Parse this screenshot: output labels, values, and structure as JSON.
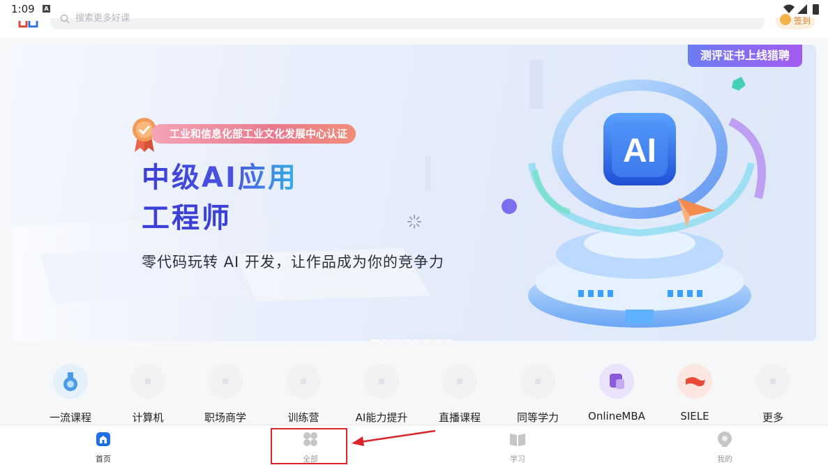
{
  "status_bar": {
    "time": "1:09",
    "notification_badge": "A"
  },
  "header": {
    "search_placeholder": "搜索更多好课",
    "signin_label": "签到"
  },
  "banner": {
    "promo_tag": "测评证书上线猎聘",
    "cert_text": "工业和信息化部工业文化发展中心认证",
    "title_line1": "中级AI应用",
    "title_line2": "工程师",
    "subtitle": "零代码玩转 AI 开发，让作品成为你的竞争力",
    "badge_text": "AI",
    "page_count": 8,
    "active_page": 0
  },
  "categories": [
    {
      "label": "一流课程",
      "icon": "medal-icon"
    },
    {
      "label": "计算机",
      "icon": "placeholder-icon"
    },
    {
      "label": "职场商学",
      "icon": "placeholder-icon"
    },
    {
      "label": "训练营",
      "icon": "placeholder-icon"
    },
    {
      "label": "AI能力提升",
      "icon": "placeholder-icon"
    },
    {
      "label": "直播课程",
      "icon": "placeholder-icon"
    },
    {
      "label": "同等学力",
      "icon": "placeholder-icon"
    },
    {
      "label": "OnlineMBA",
      "icon": "mba-icon"
    },
    {
      "label": "SIELE",
      "icon": "flag-icon"
    },
    {
      "label": "更多",
      "icon": "placeholder-icon"
    }
  ],
  "bottom_nav": [
    {
      "label": "首页",
      "icon": "home-icon",
      "active": true
    },
    {
      "label": "全部",
      "icon": "grid-icon",
      "active": false
    },
    {
      "label": "学习",
      "icon": "book-icon",
      "active": false
    },
    {
      "label": "我的",
      "icon": "profile-icon",
      "active": false
    }
  ],
  "colors": {
    "accent_blue": "#1e6fe6",
    "title_indigo": "#3a40d8",
    "highlight_red": "#d9242b"
  }
}
